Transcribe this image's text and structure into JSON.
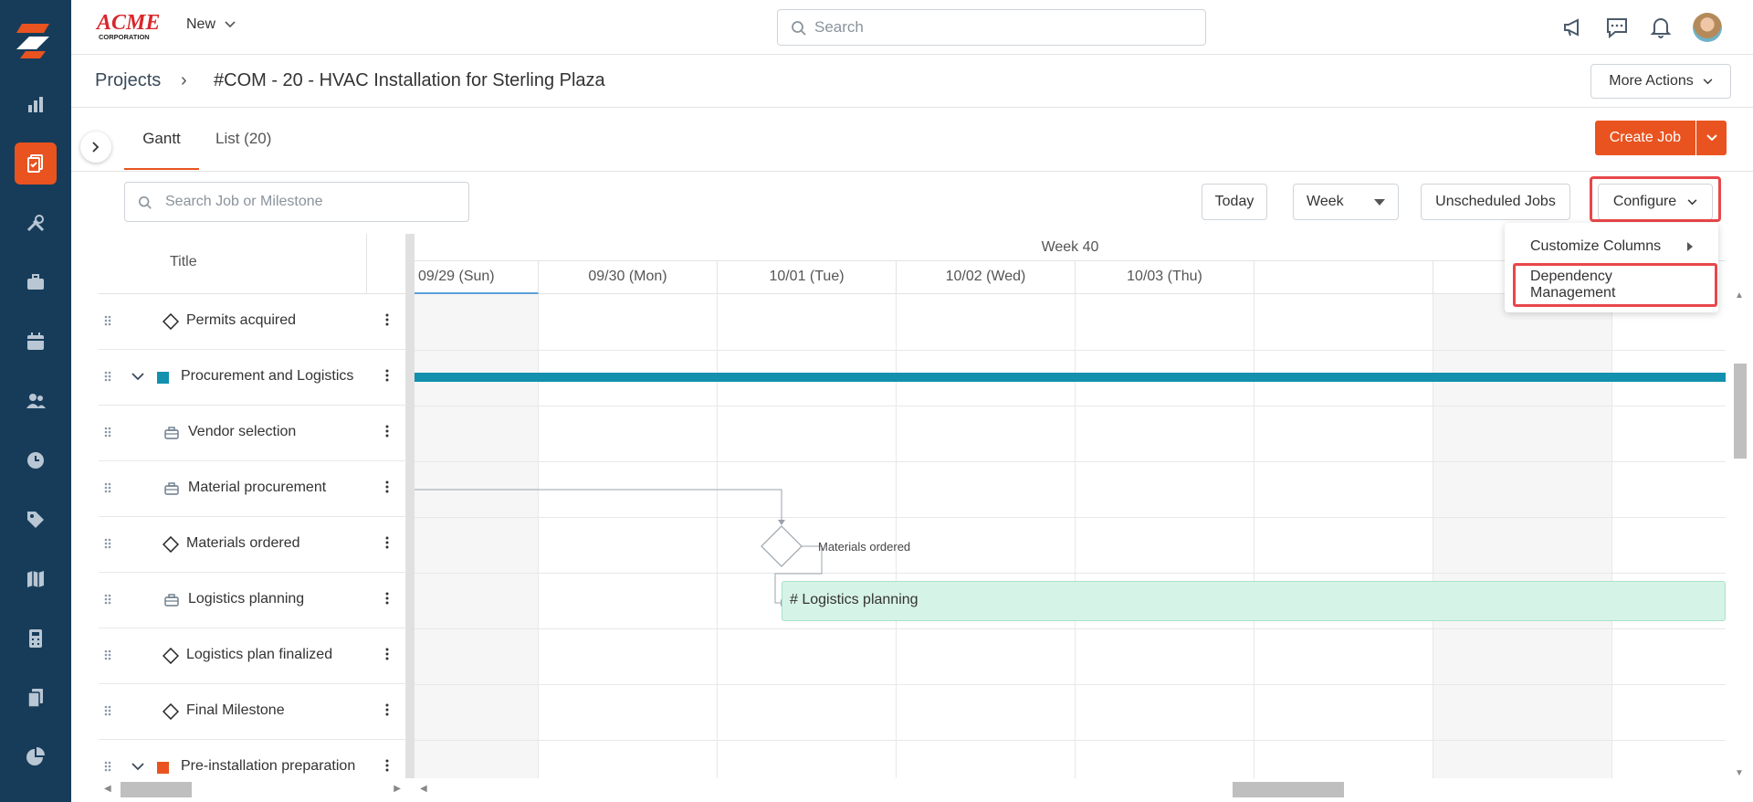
{
  "topbar": {
    "brand": "ACME CORPORATION",
    "new_label": "New",
    "search_placeholder": "Search"
  },
  "breadcrumb": {
    "root": "Projects",
    "separator": "›",
    "title": "#COM - 20 - HVAC Installation for Sterling Plaza",
    "more_actions": "More Actions"
  },
  "tabs": [
    {
      "label": "Gantt",
      "active": true
    },
    {
      "label": "List (20)",
      "active": false
    }
  ],
  "create_job_label": "Create Job",
  "toolbar": {
    "search_placeholder": "Search Job or Milestone",
    "today": "Today",
    "view": "Week",
    "unscheduled": "Unscheduled Jobs",
    "configure": "Configure"
  },
  "configure_menu": [
    {
      "label": "Customize Columns"
    },
    {
      "label": "Dependency Management"
    }
  ],
  "gantt": {
    "title_col": "Title",
    "week_label": "Week 40",
    "days": [
      "09/29 (Sun)",
      "09/30 (Mon)",
      "10/01 (Tue)",
      "10/02 (Wed)",
      "10/03 (Thu)"
    ],
    "rows": [
      {
        "label": "Permits acquired",
        "type": "milestone"
      },
      {
        "label": "Procurement and Logistics",
        "type": "group",
        "color": "#1290ae"
      },
      {
        "label": "Vendor selection",
        "type": "job"
      },
      {
        "label": "Material procurement",
        "type": "job"
      },
      {
        "label": "Materials ordered",
        "type": "milestone"
      },
      {
        "label": "Logistics planning",
        "type": "job"
      },
      {
        "label": "Logistics plan finalized",
        "type": "milestone"
      },
      {
        "label": "Final Milestone",
        "type": "milestone"
      },
      {
        "label": "Pre-installation preparation",
        "type": "group",
        "color": "#e9531f"
      }
    ],
    "milestone_caption": "Materials ordered",
    "bar_label": "# Logistics planning"
  },
  "colors": {
    "rail": "#163c5a",
    "accent": "#e9531f",
    "highlight": "#e8474a",
    "bar_blue": "#1290ae",
    "bar_green": "#d6f3e7"
  }
}
